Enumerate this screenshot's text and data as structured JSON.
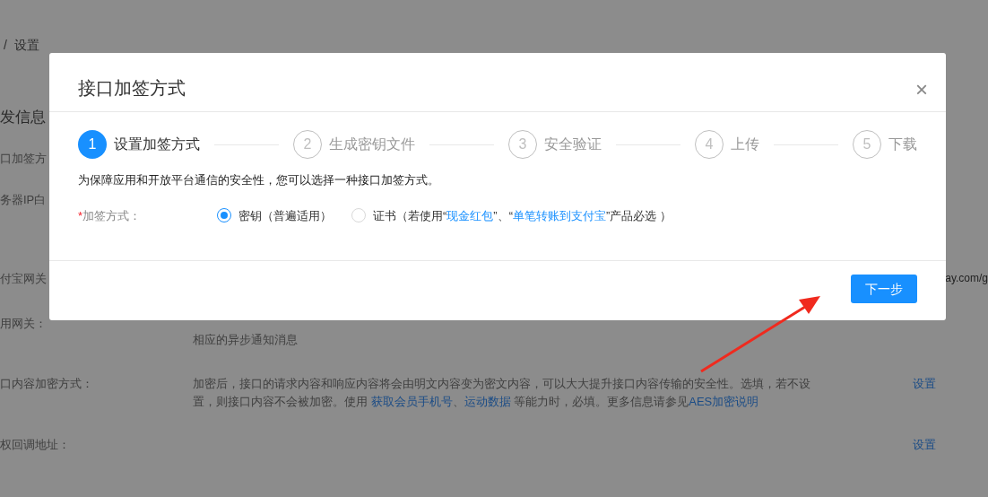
{
  "breadcrumb": {
    "separator": "/",
    "current": "设置"
  },
  "section_title": "发信息",
  "rows": [
    {
      "label": "口加签方"
    },
    {
      "label": "务器IP白"
    },
    {
      "label": "付宝网关",
      "value": "ay.com/g"
    },
    {
      "label": "用网关：",
      "description": [
        {
          "text": "相应的异步通知消息"
        }
      ]
    },
    {
      "label": "口内容加密方式：",
      "description": [
        {
          "text": "加密后，接口的请求内容和响应内容将会由明文内容变为密文内容，可以大大提升接口内容传输的安全性。选填，若不设置，则接口内容不会被加密。使用 "
        },
        {
          "text": "获取会员手机号",
          "link": true
        },
        {
          "text": "、"
        },
        {
          "text": "运动数据",
          "link": true
        },
        {
          "text": " 等能力时，必填。更多信息请参见"
        },
        {
          "text": "AES加密说明",
          "link": true
        }
      ],
      "action": "设置"
    },
    {
      "label": "权回调地址：",
      "action": "设置"
    }
  ],
  "modal": {
    "title": "接口加签方式",
    "close": "×",
    "steps": [
      {
        "number": "1",
        "label": "设置加签方式",
        "current": true
      },
      {
        "number": "2",
        "label": "生成密钥文件",
        "current": false
      },
      {
        "number": "3",
        "label": "安全验证",
        "current": false
      },
      {
        "number": "4",
        "label": "上传",
        "current": false
      },
      {
        "number": "5",
        "label": "下载",
        "current": false
      }
    ],
    "intro": "为保障应用和开放平台通信的安全性，您可以选择一种接口加签方式。",
    "field": {
      "required_mark": "*",
      "label": "加签方式：",
      "options": [
        {
          "parts": [
            {
              "text": "密钥（普遍适用）"
            }
          ],
          "selected": true
        },
        {
          "parts": [
            {
              "text": "证书（若使用“"
            },
            {
              "text": "现金红包",
              "link": true
            },
            {
              "text": "”、“"
            },
            {
              "text": "单笔转账到支付宝",
              "link": true
            },
            {
              "text": "”产品必选 ）"
            }
          ],
          "selected": false
        }
      ]
    },
    "next_button": "下一步"
  }
}
